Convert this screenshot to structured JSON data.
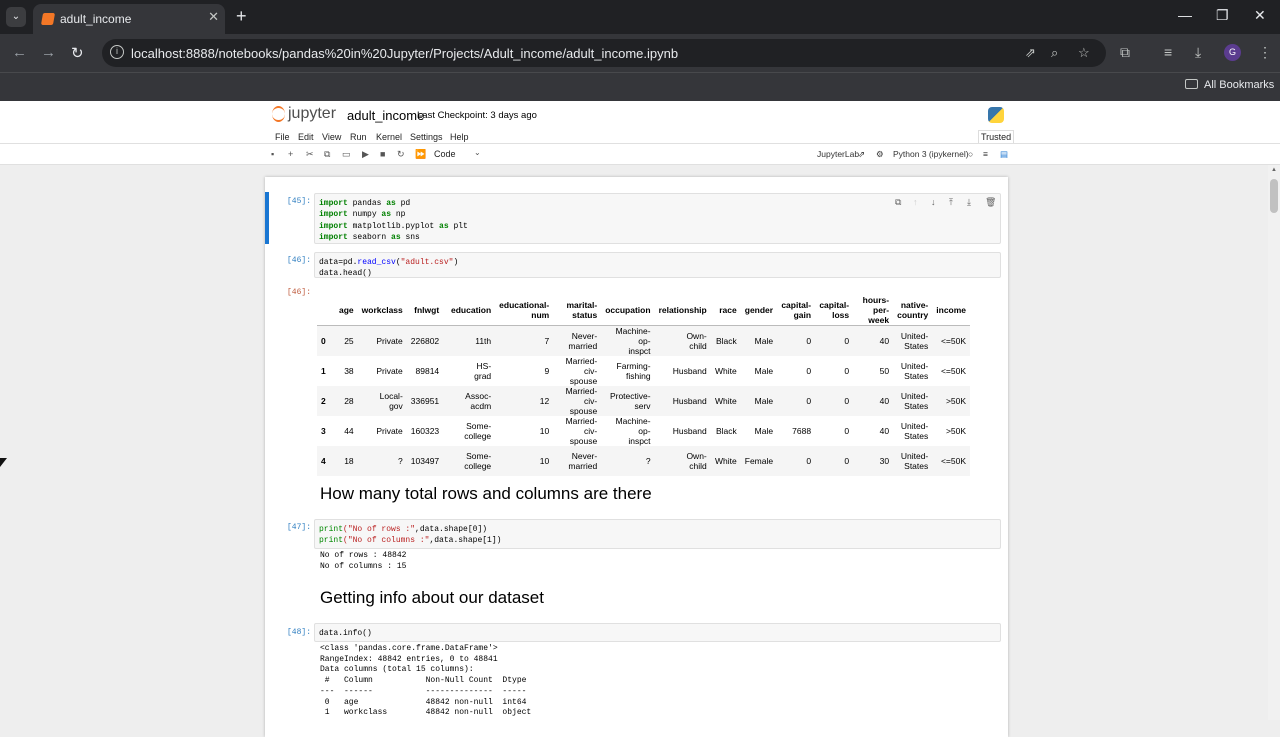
{
  "browser": {
    "tab_title": "adult_income",
    "tab_close": "✕",
    "new_tab": "+",
    "tab_dropdown": "⌄",
    "url": "localhost:8888/notebooks/pandas%20in%20Jupyter/Projects/Adult_income/adult_income.ipynb",
    "bookmarks_label": "All Bookmarks",
    "avatar_letter": "G",
    "win_min": "—",
    "win_max": "❐",
    "win_close": "✕",
    "back": "←",
    "forward": "→",
    "reload": "↻",
    "info": "i"
  },
  "jupyter": {
    "logo_text": "jupyter",
    "notebook_name": "adult_income",
    "checkpoint": "Last Checkpoint: 3 days ago",
    "trusted": "Trusted",
    "menu": [
      "File",
      "Edit",
      "View",
      "Run",
      "Kernel",
      "Settings",
      "Help"
    ],
    "toolbar_cell_type": "Code",
    "jupyterlab_link": "JupyterLab",
    "kernel_name": "Python 3 (ipykernel)"
  },
  "cells": {
    "c45": {
      "prompt": "[45]:",
      "lines": [
        {
          "kw": "import",
          "rest": " pandas ",
          "kw2": "as",
          "rest2": " pd"
        },
        {
          "kw": "import",
          "rest": " numpy ",
          "kw2": "as",
          "rest2": " np"
        },
        {
          "kw": "import",
          "rest": " matplotlib.pyplot ",
          "kw2": "as",
          "rest2": " plt"
        },
        {
          "kw": "import",
          "rest": " seaborn ",
          "kw2": "as",
          "rest2": " sns"
        }
      ]
    },
    "c46": {
      "prompt": "[46]:",
      "out_prompt": "[46]:",
      "line1_a": "data=pd.",
      "line1_fn": "read_csv",
      "line1_b": "(",
      "line1_str": "\"adult.csv\"",
      "line1_c": ")",
      "line2": "data.head()"
    },
    "c47": {
      "prompt": "[47]:",
      "line1_fn": "print",
      "line1_str": "(\"No of rows :\"",
      "line1_rest": ",data.shape[0])",
      "line2_fn": "print",
      "line2_str": "(\"No of columns :\"",
      "line2_rest": ",data.shape[1])",
      "output": "No of rows : 48842\nNo of columns : 15"
    },
    "c48": {
      "prompt": "[48]:",
      "code": "data.info()",
      "output": "<class 'pandas.core.frame.DataFrame'>\nRangeIndex: 48842 entries, 0 to 48841\nData columns (total 15 columns):\n #   Column           Non-Null Count  Dtype \n---  ------           --------------  ----- \n 0   age              48842 non-null  int64 \n 1   workclass        48842 non-null  object"
    }
  },
  "headings": {
    "h1": "How many total rows and columns are there",
    "h2": "Getting info about our dataset"
  },
  "dataframe": {
    "columns": [
      "",
      "age",
      "workclass",
      "fnlwgt",
      "education",
      "educational-num",
      "marital-status",
      "occupation",
      "relationship",
      "race",
      "gender",
      "capital-gain",
      "capital-loss",
      "hours-per-week",
      "native-country",
      "income"
    ],
    "rows": [
      [
        "0",
        "25",
        "Private",
        "226802",
        "11th",
        "7",
        "Never-married",
        "Machine-op-inspct",
        "Own-child",
        "Black",
        "Male",
        "0",
        "0",
        "40",
        "United-States",
        "<=50K"
      ],
      [
        "1",
        "38",
        "Private",
        "89814",
        "HS-grad",
        "9",
        "Married-civ-spouse",
        "Farming-fishing",
        "Husband",
        "White",
        "Male",
        "0",
        "0",
        "50",
        "United-States",
        "<=50K"
      ],
      [
        "2",
        "28",
        "Local-gov",
        "336951",
        "Assoc-acdm",
        "12",
        "Married-civ-spouse",
        "Protective-serv",
        "Husband",
        "White",
        "Male",
        "0",
        "0",
        "40",
        "United-States",
        ">50K"
      ],
      [
        "3",
        "44",
        "Private",
        "160323",
        "Some-college",
        "10",
        "Married-civ-spouse",
        "Machine-op-inspct",
        "Husband",
        "Black",
        "Male",
        "7688",
        "0",
        "40",
        "United-States",
        ">50K"
      ],
      [
        "4",
        "18",
        "?",
        "103497",
        "Some-college",
        "10",
        "Never-married",
        "?",
        "Own-child",
        "White",
        "Female",
        "0",
        "0",
        "30",
        "United-States",
        "<=50K"
      ]
    ]
  },
  "colors": {
    "accent": "#1976d2",
    "jupyter_orange": "#f37726",
    "keyword_green": "#008000",
    "string_red": "#ba2121"
  }
}
